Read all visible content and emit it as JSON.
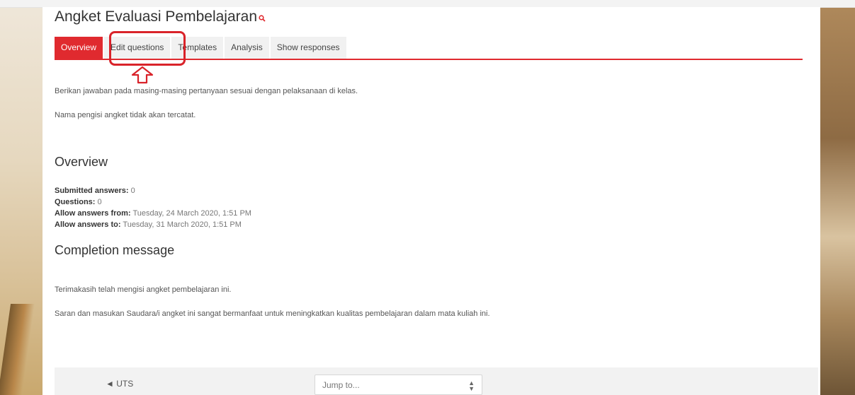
{
  "page": {
    "title": "Angket Evaluasi Pembelajaran",
    "title_icon": "search-icon"
  },
  "tabs": [
    {
      "label": "Overview",
      "active": true
    },
    {
      "label": "Edit questions",
      "active": false
    },
    {
      "label": "Templates",
      "active": false
    },
    {
      "label": "Analysis",
      "active": false
    },
    {
      "label": "Show responses",
      "active": false
    }
  ],
  "intro": {
    "line1": "Berikan jawaban pada masing-masing pertanyaan sesuai dengan pelaksanaan di kelas.",
    "line2": "Nama pengisi angket tidak akan tercatat."
  },
  "overview": {
    "heading": "Overview",
    "submitted_label": "Submitted answers:",
    "submitted_value": "0",
    "questions_label": "Questions:",
    "questions_value": "0",
    "from_label": "Allow answers from:",
    "from_value": "Tuesday, 24 March 2020, 1:51 PM",
    "to_label": "Allow answers to:",
    "to_value": "Tuesday, 31 March 2020, 1:51 PM"
  },
  "completion": {
    "heading": "Completion message",
    "line1": "Terimakasih telah mengisi angket pembelajaran ini.",
    "line2": "Saran dan masukan Saudara/i angket ini  sangat bermanfaat untuk meningkatkan kualitas pembelajaran dalam mata kuliah ini."
  },
  "footer": {
    "prev_label": "◄ UTS",
    "jump_placeholder": "Jump to..."
  },
  "colors": {
    "accent": "#e02a2f",
    "annotation": "#d9232a"
  }
}
